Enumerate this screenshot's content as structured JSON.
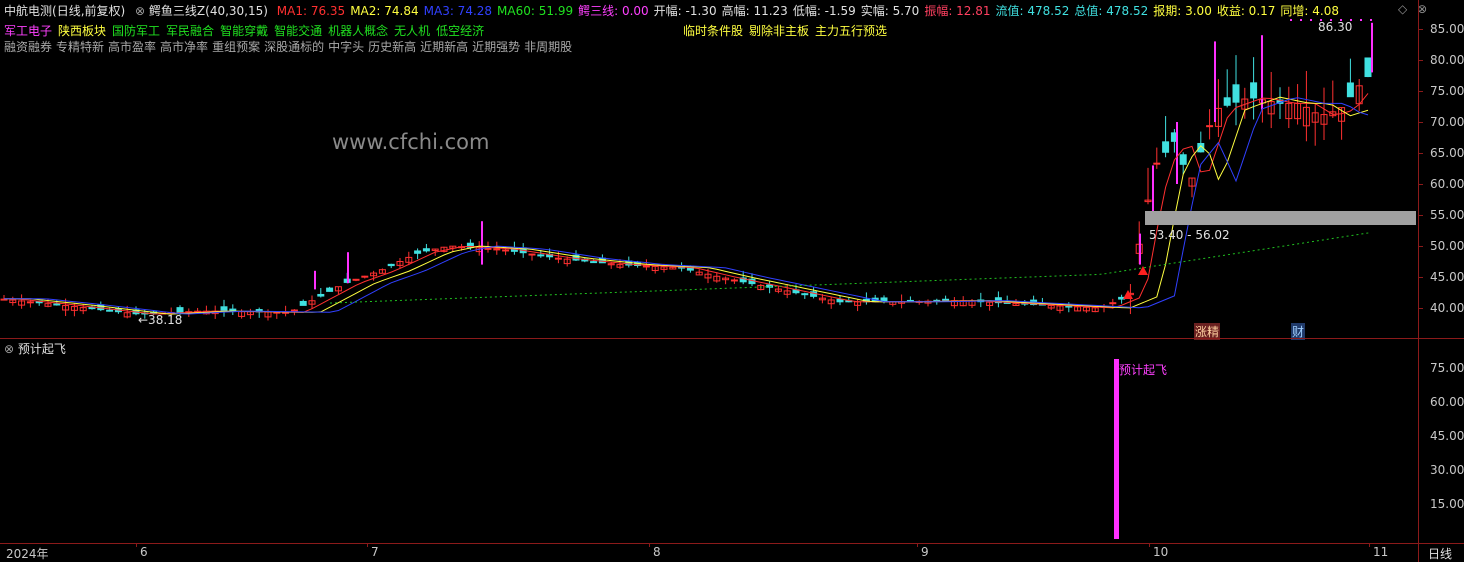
{
  "header": {
    "stock_title": "中航电测",
    "period": "(日线,前复权)",
    "indicator_name": "鳄鱼三线Z(40,30,15)",
    "stats": [
      {
        "label": "MA1: ",
        "value": "76.35",
        "color": "#ff3030"
      },
      {
        "label": "MA2: ",
        "value": "74.84",
        "color": "#ffff40"
      },
      {
        "label": "MA3: ",
        "value": "74.28",
        "color": "#3040ff"
      },
      {
        "label": "MA60: ",
        "value": "51.99",
        "color": "#20e020"
      },
      {
        "label": "鳄三线: ",
        "value": "0.00",
        "color": "#ff40ff"
      },
      {
        "label": "开幅: ",
        "value": "-1.30",
        "color": "#e0e0e0"
      },
      {
        "label": "高幅: ",
        "value": "11.23",
        "color": "#e0e0e0"
      },
      {
        "label": "低幅: ",
        "value": "-1.59",
        "color": "#e0e0e0"
      },
      {
        "label": "实幅: ",
        "value": "5.70",
        "color": "#e0e0e0"
      },
      {
        "label": "振幅: ",
        "value": "12.81",
        "color": "#ff4060"
      },
      {
        "label": "流值: ",
        "value": "478.52",
        "color": "#40e0e0"
      },
      {
        "label": "总值: ",
        "value": "478.52",
        "color": "#40e0e0"
      },
      {
        "label": "报期: ",
        "value": "3.00",
        "color": "#ffff40"
      },
      {
        "label": "收益: ",
        "value": "0.17",
        "color": "#ffff40"
      },
      {
        "label": "同增: ",
        "value": "4.08",
        "color": "#ffff40"
      }
    ]
  },
  "concepts_row1": [
    {
      "text": "军工电子",
      "color": "#ff40ff"
    },
    {
      "text": "陕西板块",
      "color": "#ffff40"
    },
    {
      "text": "国防军工",
      "color": "#20e020"
    },
    {
      "text": "军民融合",
      "color": "#20e020"
    },
    {
      "text": "智能穿戴",
      "color": "#20e020"
    },
    {
      "text": "智能交通",
      "color": "#20e020"
    },
    {
      "text": "机器人概念",
      "color": "#20e020"
    },
    {
      "text": "无人机",
      "color": "#20e020"
    },
    {
      "text": "低空经济",
      "color": "#20e020"
    }
  ],
  "concepts_center": [
    {
      "text": "临时条件股"
    },
    {
      "text": "剔除非主板"
    },
    {
      "text": "主力五行预选"
    }
  ],
  "concepts_row2": [
    "融资融券",
    "专精特新",
    "高市盈率",
    "高市净率",
    "重组预案",
    "深股通标的",
    "中字头",
    "历史新高",
    "近期新高",
    "近期强势",
    "非周期股"
  ],
  "watermark": "www.cfchi.com",
  "annotations": {
    "high_label": "86.30",
    "low_label": "←38.18",
    "range_label": "53.40 - 56.02",
    "zhangting": "涨",
    "jing": "精",
    "cai": "财"
  },
  "price_axis": [
    "85.00",
    "80.00",
    "75.00",
    "70.00",
    "65.00",
    "60.00",
    "55.00",
    "50.00",
    "45.00",
    "40.00"
  ],
  "indicator": {
    "name": "预计起飞",
    "signal_label": "预计起飞",
    "axis": [
      "75.00",
      "60.00",
      "45.00",
      "30.00",
      "15.00"
    ]
  },
  "time_axis": [
    "2024年",
    "6",
    "7",
    "8",
    "9",
    "10",
    "11"
  ],
  "period_button": "日线"
}
